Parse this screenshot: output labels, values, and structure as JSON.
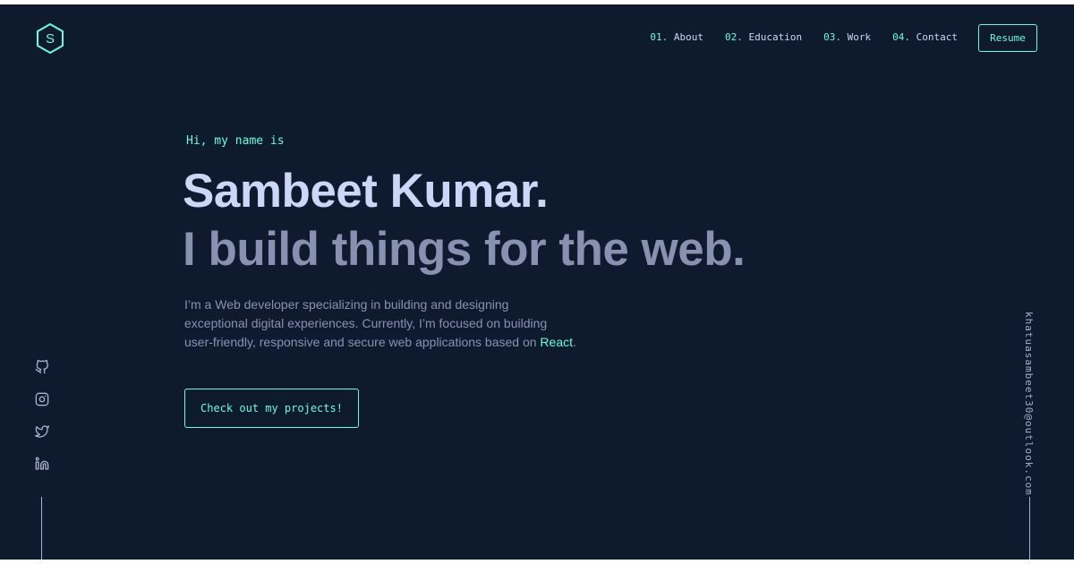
{
  "header": {
    "logo_letter": "S",
    "nav": [
      {
        "num": "01.",
        "label": "About"
      },
      {
        "num": "02.",
        "label": "Education"
      },
      {
        "num": "03.",
        "label": "Work"
      },
      {
        "num": "04.",
        "label": "Contact"
      }
    ],
    "resume_label": "Resume"
  },
  "hero": {
    "greeting": "Hi, my name is",
    "name": "Sambeet Kumar.",
    "tagline": "I build things for the web.",
    "bio_lines": [
      "I’m a Web developer specializing in building and designing",
      "exceptional digital experiences. Currently, I’m focused on building",
      "user-friendly, responsive and secure web applications based on "
    ],
    "bio_highlight": "React",
    "bio_end": ".",
    "cta_label": "Check out my projects!"
  },
  "social": {
    "icons": [
      "github-icon",
      "instagram-icon",
      "twitter-icon",
      "linkedin-icon"
    ]
  },
  "email": "khatuasambeet30@outlook.com",
  "colors": {
    "background": "#0e1a2e",
    "accent": "#64ffda",
    "heading": "#ccd6f6",
    "muted": "#8892b0"
  }
}
